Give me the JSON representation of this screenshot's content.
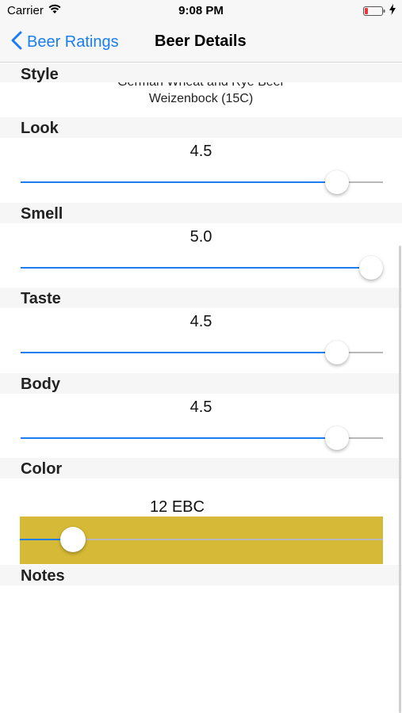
{
  "status_bar": {
    "carrier": "Carrier",
    "time": "9:08 PM"
  },
  "nav": {
    "back_label": "Beer Ratings",
    "title": "Beer Details"
  },
  "style": {
    "header": "Style",
    "line1": "German Wheat and Rye Beer",
    "line2": "Weizenbock (15C)"
  },
  "look": {
    "header": "Look",
    "value": "4.5",
    "level": 0.9
  },
  "smell": {
    "header": "Smell",
    "value": "5.0",
    "level": 1.0
  },
  "taste": {
    "header": "Taste",
    "value": "4.5",
    "level": 0.9
  },
  "body": {
    "header": "Body",
    "value": "4.5",
    "level": 0.9
  },
  "color": {
    "header": "Color",
    "value": "12 EBC",
    "level": 0.12,
    "swatch": "#d6b936"
  },
  "notes": {
    "header": "Notes"
  },
  "colors": {
    "accent": "#1a7ef2",
    "battery_low": "#e8383d"
  },
  "icons": {
    "wifi": "wifi-icon",
    "battery": "battery-icon",
    "charging": "charging-bolt-icon",
    "back": "chevron-left-icon"
  }
}
